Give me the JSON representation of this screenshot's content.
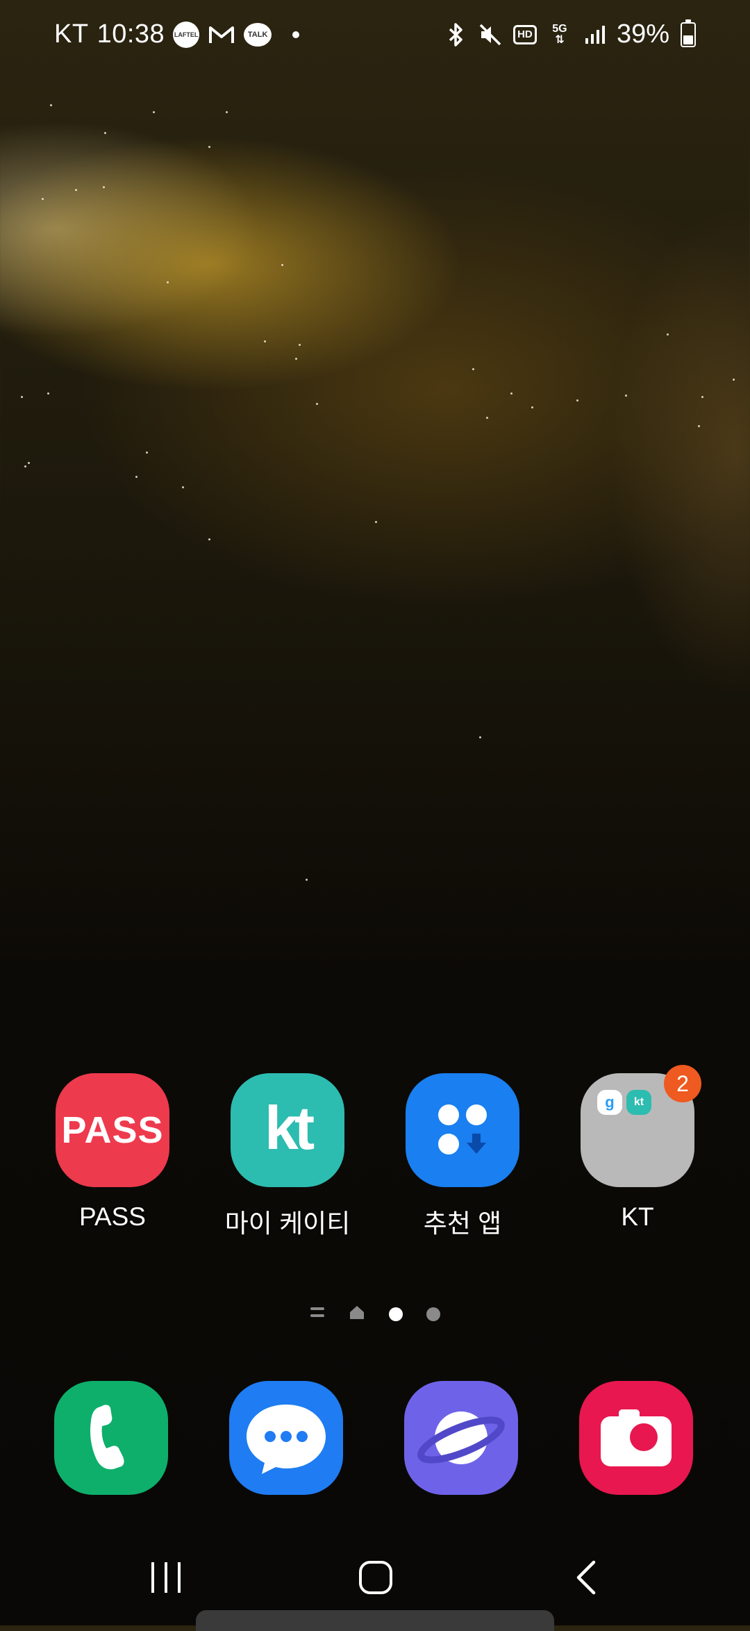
{
  "status_bar": {
    "carrier": "KT",
    "time": "10:38",
    "notification_icons": [
      "laftel-icon",
      "gmail-icon",
      "kakaotalk-icon"
    ],
    "talk_label": "TALK",
    "laftel_label": "LAFTEL",
    "battery_percent": "39%",
    "battery_level": 0.39,
    "hd_label": "HD",
    "network_label": "5G"
  },
  "apps": [
    {
      "label": "PASS",
      "icon_text": "PASS",
      "color": "#ee3a4d"
    },
    {
      "label": "마이 케이티",
      "icon_text": "kt",
      "color": "#2dbcb0"
    },
    {
      "label": "추천 앱",
      "color": "#1a7ff0"
    },
    {
      "label": "KT",
      "color": "#b9b9b9",
      "badge": "2",
      "mini_apps": [
        "g",
        "kt"
      ]
    }
  ],
  "page_indicator": {
    "pages": 4,
    "active_index": 2
  },
  "dock": [
    {
      "name": "phone",
      "color": "#0eaf6b"
    },
    {
      "name": "messages",
      "color": "#1f7cf2"
    },
    {
      "name": "internet",
      "color": "#6e63e8"
    },
    {
      "name": "camera",
      "color": "#e8174f"
    }
  ]
}
